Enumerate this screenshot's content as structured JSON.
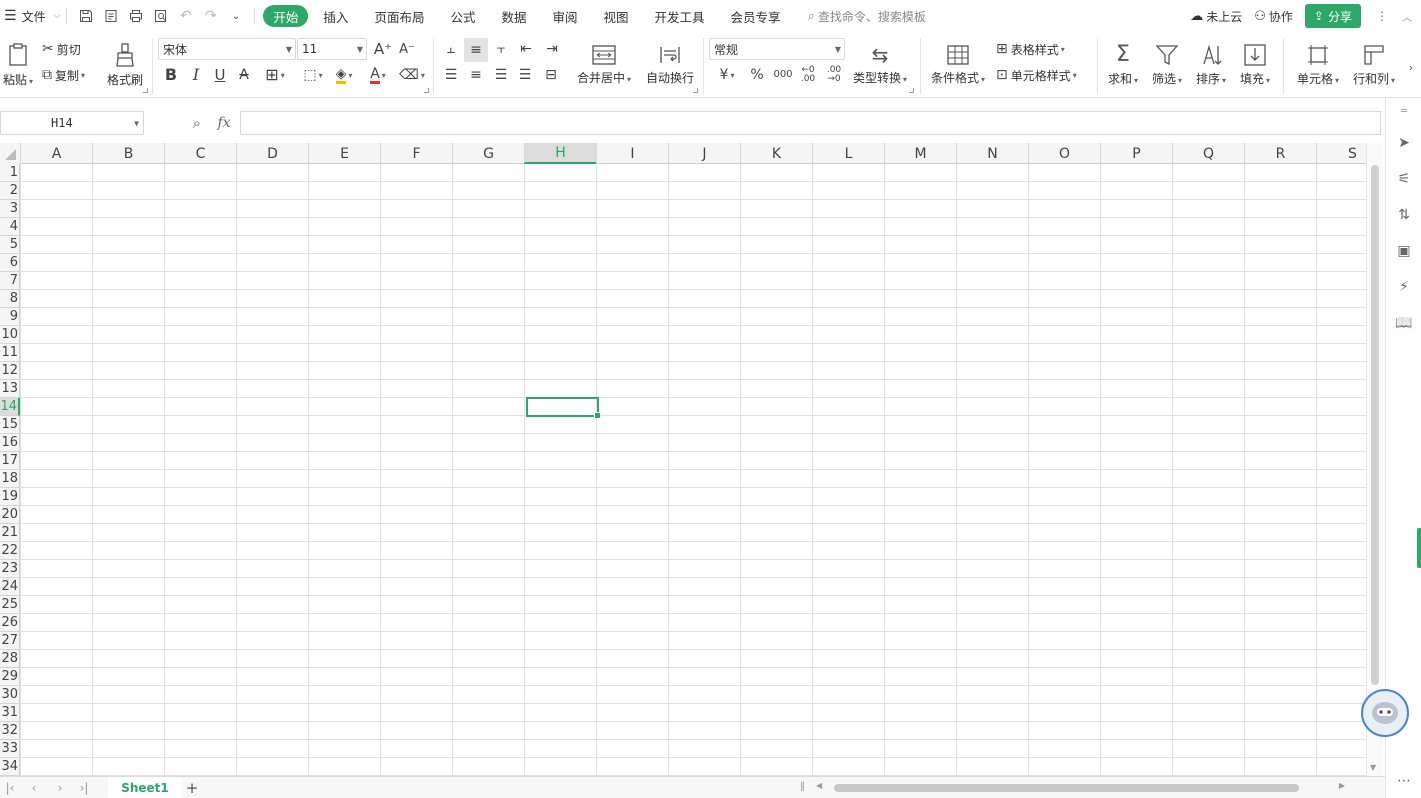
{
  "menubar": {
    "file_label": "文件",
    "tabs": [
      {
        "label": "开始",
        "active": true
      },
      {
        "label": "插入",
        "active": false
      },
      {
        "label": "页面布局",
        "active": false
      },
      {
        "label": "公式",
        "active": false
      },
      {
        "label": "数据",
        "active": false
      },
      {
        "label": "审阅",
        "active": false
      },
      {
        "label": "视图",
        "active": false
      },
      {
        "label": "开发工具",
        "active": false
      },
      {
        "label": "会员专享",
        "active": false
      }
    ],
    "search_placeholder": "查找命令、搜索模板",
    "cloud_label": "未上云",
    "collab_label": "协作",
    "share_label": "分享"
  },
  "ribbon": {
    "paste": "粘贴",
    "cut": "剪切",
    "copy": "复制",
    "format_painter": "格式刷",
    "font_name": "宋体",
    "font_size": "11",
    "merge_center": "合并居中",
    "wrap_text": "自动换行",
    "number_format": "常规",
    "type_convert": "类型转换",
    "cond_format": "条件格式",
    "table_style": "表格样式",
    "cell_style": "单元格样式",
    "sum": "求和",
    "filter": "筛选",
    "sort": "排序",
    "fill": "填充",
    "cell": "单元格",
    "row_col": "行和列"
  },
  "formula_bar": {
    "cell_ref": "H14",
    "fx_label": "fx",
    "content": ""
  },
  "sheet": {
    "columns": [
      "A",
      "B",
      "C",
      "D",
      "E",
      "F",
      "G",
      "H",
      "I",
      "J",
      "K",
      "L",
      "M",
      "N",
      "O",
      "P",
      "Q",
      "R",
      "S"
    ],
    "active_column": "H",
    "active_row": 14,
    "rows": [
      1,
      2,
      3,
      4,
      5,
      6,
      7,
      8,
      9,
      10,
      11,
      12,
      13,
      14,
      15,
      16,
      17,
      18,
      19,
      20,
      21,
      22,
      23,
      24,
      25,
      26,
      27,
      28,
      29,
      30,
      31,
      32,
      33,
      34
    ]
  },
  "sheet_tabs": {
    "tabs": [
      "Sheet1"
    ],
    "active": "Sheet1",
    "add_label": "+"
  },
  "colors": {
    "accent": "#2ea869",
    "grid_line": "#e1e1e1",
    "header_bg": "#f5f5f5"
  }
}
